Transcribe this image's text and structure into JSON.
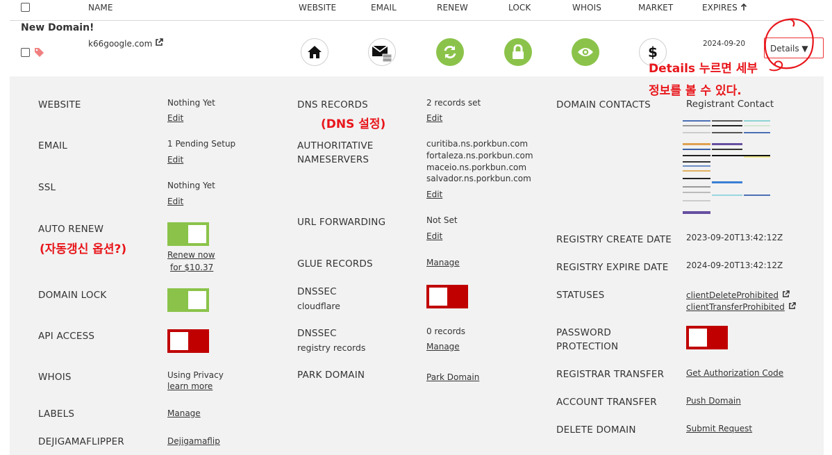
{
  "header": {
    "name": "NAME",
    "website": "WEBSITE",
    "email": "EMAIL",
    "renew": "RENEW",
    "lock": "LOCK",
    "whois": "WHOIS",
    "market": "MARKET",
    "expires": "EXPIRES"
  },
  "domain_row": {
    "group_label": "New Domain!",
    "domain": "k66google.com",
    "expires": "2024-09-20",
    "details_label": "Details ▼",
    "icons": [
      "home-icon",
      "email-icon",
      "renew-icon",
      "lock-icon",
      "eye-icon",
      "dollar-icon"
    ]
  },
  "annotations": {
    "details_note_1": "Details 누르면 세부",
    "details_note_2": "정보를 볼 수 있다.",
    "dns_note": "(DNS 설정)",
    "autorenew_note": "(자동갱신 옵션?)"
  },
  "col1": {
    "website": {
      "label": "WEBSITE",
      "value": "Nothing Yet",
      "link": "Edit"
    },
    "email": {
      "label": "EMAIL",
      "value": "1 Pending Setup",
      "link": "Edit"
    },
    "ssl": {
      "label": "SSL",
      "value": "Nothing Yet",
      "link": "Edit"
    },
    "auto_renew": {
      "label": "AUTO RENEW",
      "enabled": true,
      "link1": "Renew now",
      "link2": "for $10.37"
    },
    "domain_lock": {
      "label": "DOMAIN LOCK",
      "enabled": true
    },
    "api_access": {
      "label": "API ACCESS",
      "enabled": false
    },
    "whois": {
      "label": "WHOIS",
      "value": "Using Privacy",
      "link": "learn more"
    },
    "labels": {
      "label": "LABELS",
      "link": "Manage"
    },
    "dejigamaflipper": {
      "label": "DEJIGAMAFLIPPER",
      "link": "Dejigamaflip"
    }
  },
  "col2": {
    "dns_records": {
      "label": "DNS RECORDS",
      "value": "2 records set",
      "link": "Edit"
    },
    "nameservers": {
      "label1": "AUTHORITATIVE",
      "label2": "NAMESERVERS",
      "values": [
        "curitiba.ns.porkbun.com",
        "fortaleza.ns.porkbun.com",
        "maceio.ns.porkbun.com",
        "salvador.ns.porkbun.com"
      ],
      "link": "Edit"
    },
    "url_forwarding": {
      "label": "URL FORWARDING",
      "value": "Not Set",
      "link": "Edit"
    },
    "glue_records": {
      "label": "GLUE RECORDS",
      "link": "Manage"
    },
    "dnssec_cf": {
      "label": "DNSSEC",
      "sublabel": "cloudflare",
      "enabled": false
    },
    "dnssec_reg": {
      "label": "DNSSEC",
      "sublabel": "registry records",
      "value": "0 records",
      "link": "Manage"
    },
    "park_domain": {
      "label": "PARK DOMAIN",
      "link": "Park Domain"
    }
  },
  "col3": {
    "domain_contacts": {
      "label": "DOMAIN CONTACTS",
      "value": "Registrant Contact"
    },
    "create_date": {
      "label": "REGISTRY CREATE DATE",
      "value": "2023-09-20T13:42:12Z"
    },
    "expire_date": {
      "label": "REGISTRY EXPIRE DATE",
      "value": "2024-09-20T13:42:12Z"
    },
    "statuses": {
      "label": "STATUSES",
      "links": [
        "clientDeleteProhibited",
        "clientTransferProhibited"
      ]
    },
    "password_protection": {
      "label1": "PASSWORD",
      "label2": "PROTECTION",
      "enabled": false
    },
    "registrar_transfer": {
      "label": "REGISTRAR TRANSFER",
      "link": "Get Authorization Code"
    },
    "account_transfer": {
      "label": "ACCOUNT TRANSFER",
      "link": "Push Domain"
    },
    "delete_domain": {
      "label": "DELETE DOMAIN",
      "link": "Submit Request"
    }
  },
  "colors": {
    "toggle_on": "#8bc34a",
    "toggle_off": "#c00000",
    "annotation": "#e8161b",
    "panel_bg": "#f2f2f2"
  }
}
